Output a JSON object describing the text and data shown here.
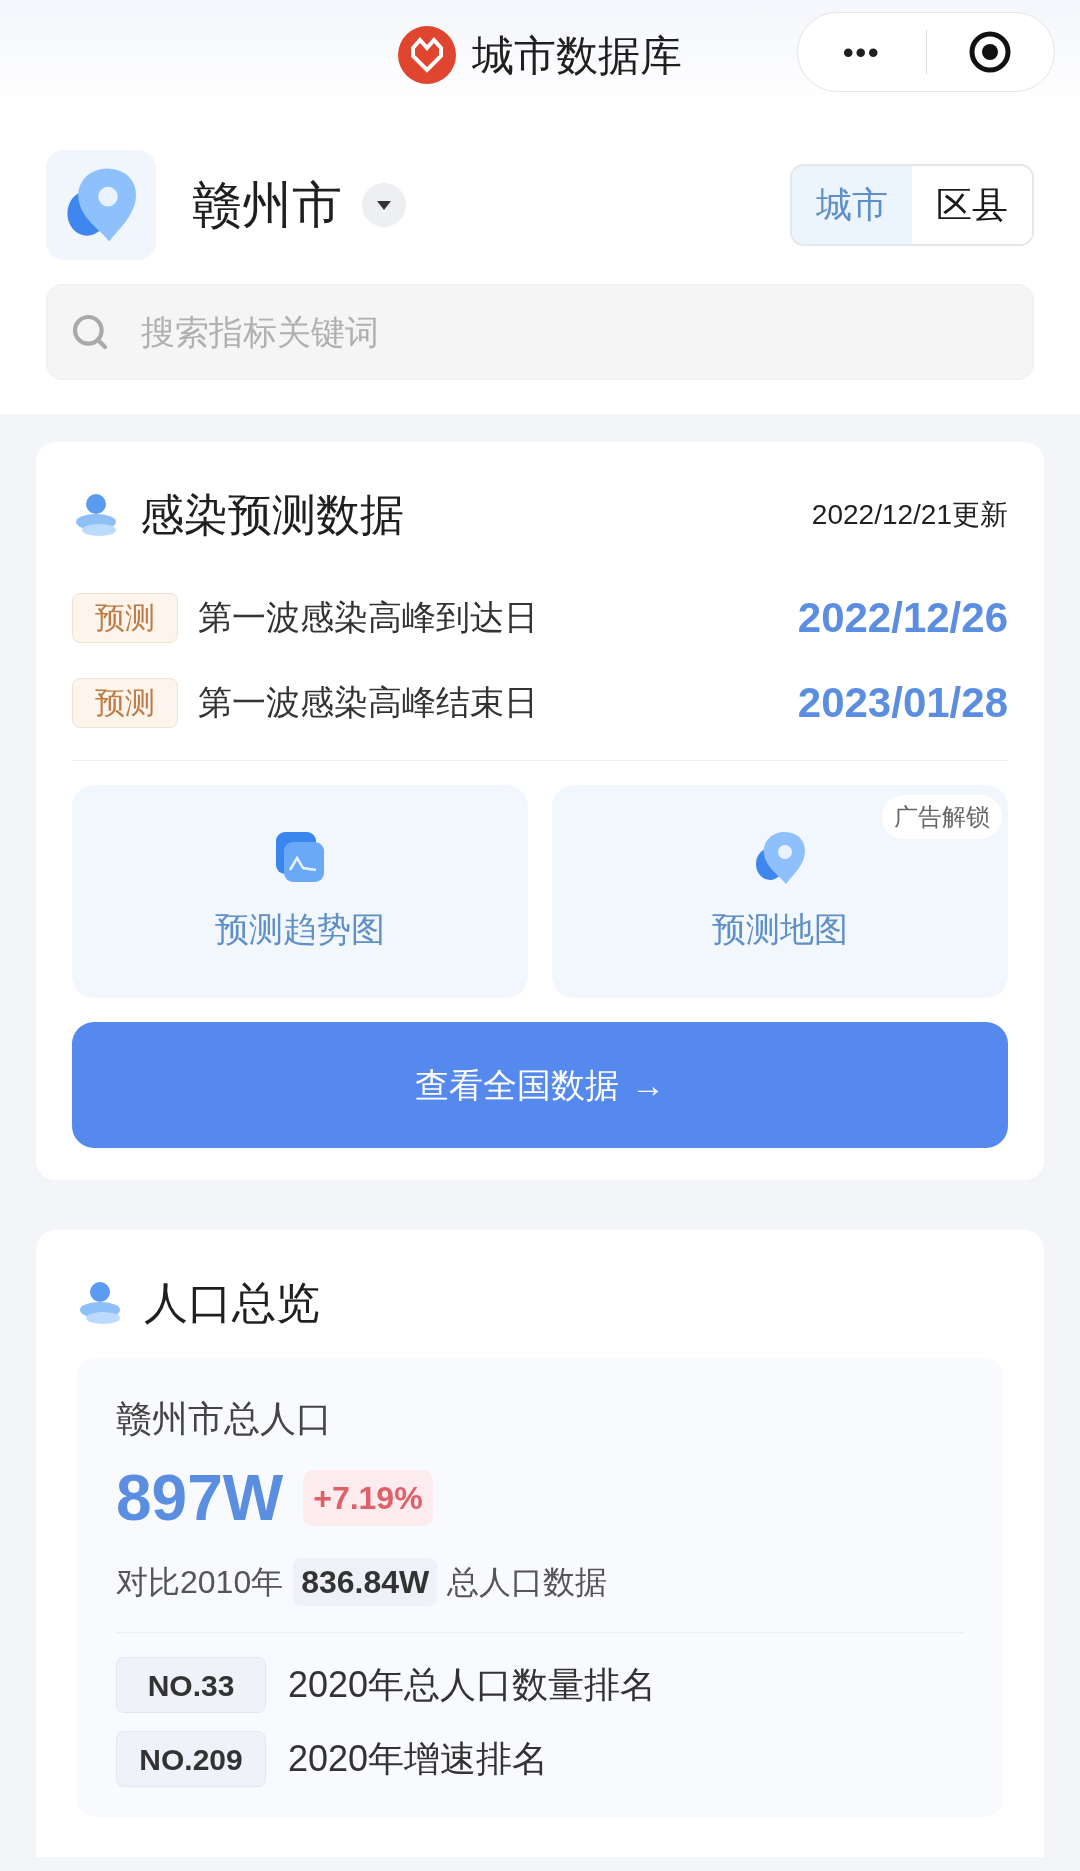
{
  "top_bar": {
    "title": "城市数据库",
    "menu_icon": "•••"
  },
  "city_selector": {
    "name": "赣州市"
  },
  "scope_tabs": [
    {
      "label": "城市",
      "selected": true
    },
    {
      "label": "区县",
      "selected": false
    }
  ],
  "search": {
    "placeholder": "搜索指标关键词"
  },
  "forecast_card": {
    "title": "感染预测数据",
    "updated": "2022/12/21更新",
    "rows": [
      {
        "tag": "预测",
        "label": "第一波感染高峰到达日",
        "date": "2022/12/26"
      },
      {
        "tag": "预测",
        "label": "第一波感染高峰结束日",
        "date": "2023/01/28"
      }
    ],
    "tiles": [
      {
        "kind": "chart",
        "label": "预测趋势图"
      },
      {
        "kind": "map",
        "label": "预测地图",
        "badge": "广告解锁"
      }
    ],
    "button": {
      "label": "查看全国数据",
      "arrow": "→"
    }
  },
  "population_card": {
    "title": "人口总览",
    "subtitle": "赣州市总人口",
    "value": "897W",
    "change": "+7.19%",
    "compare_prefix": "对比2010年",
    "compare_value": "836.84W",
    "compare_suffix": "总人口数据",
    "ranks": [
      {
        "rank": "NO.33",
        "label": "2020年总人口数量排名"
      },
      {
        "rank": "NO.209",
        "label": "2020年增速排名"
      }
    ]
  }
}
